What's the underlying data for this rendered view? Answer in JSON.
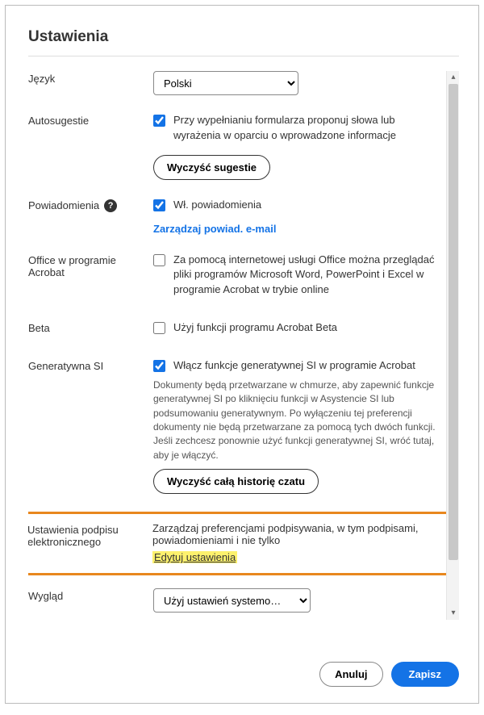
{
  "title": "Ustawienia",
  "language": {
    "label": "Język",
    "selected": "Polski"
  },
  "autosuggest": {
    "label": "Autosugestie",
    "checkbox_text": "Przy wypełnianiu formularza proponuj słowa lub wyrażenia w oparciu o wprowadzone informacje",
    "button": "Wyczyść sugestie"
  },
  "notifications": {
    "label": "Powiadomienia",
    "checkbox_text": "Wł. powiadomienia",
    "link": "Zarządzaj powiad. e-mail"
  },
  "office": {
    "label": "Office w programie Acrobat",
    "checkbox_text": "Za pomocą internetowej usługi Office można przeglądać pliki programów Microsoft Word, PowerPoint i Excel w programie Acrobat w trybie online"
  },
  "beta": {
    "label": "Beta",
    "checkbox_text": "Użyj funkcji programu Acrobat Beta"
  },
  "genai": {
    "label": "Generatywna SI",
    "checkbox_text": "Włącz funkcje generatywnej SI w programie Acrobat",
    "description": "Dokumenty będą przetwarzane w chmurze, aby zapewnić funkcje generatywnej SI po kliknięciu funkcji w Asystencie SI lub podsumowaniu generatywnym. Po wyłączeniu tej preferencji dokumenty nie będą przetwarzane za pomocą tych dwóch funkcji. Jeśli zechcesz ponownie użyć funkcji generatywnej SI, wróć tutaj, aby je włączyć.",
    "button": "Wyczyść całą historię czatu"
  },
  "esign": {
    "label": "Ustawienia podpisu elektronicznego",
    "description": "Zarządzaj preferencjami podpisywania, w tym podpisami, powiadomieniami i nie tylko",
    "link": "Edytuj ustawienia"
  },
  "appearance": {
    "label": "Wygląd",
    "selected": "Użyj ustawień systemo…"
  },
  "footer": {
    "cancel": "Anuluj",
    "save": "Zapisz"
  }
}
